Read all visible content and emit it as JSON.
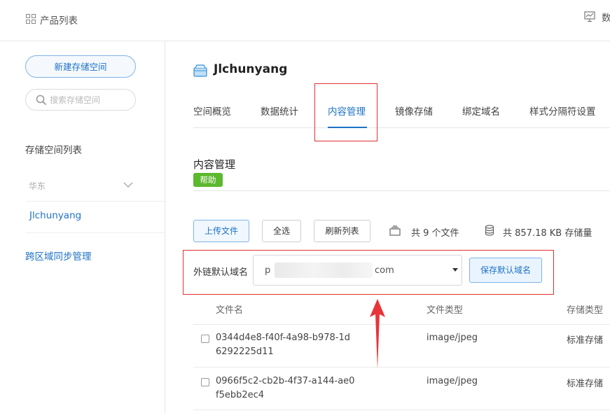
{
  "topbar": {
    "title": "产品列表",
    "right_text": "数"
  },
  "sidebar": {
    "new_bucket_label": "新建存储空间",
    "search_placeholder": "搜索存储空间",
    "list_heading": "存储空间列表",
    "region": "华东",
    "bucket_item": "Jlchunyang",
    "cross_region_link": "跨区域同步管理"
  },
  "main": {
    "bucket_title": "Jlchunyang",
    "tabs": [
      {
        "label": "空间概览"
      },
      {
        "label": "数据统计"
      },
      {
        "label": "内容管理",
        "active": true
      },
      {
        "label": "镜像存储"
      },
      {
        "label": "绑定域名"
      },
      {
        "label": "样式分隔符设置"
      }
    ],
    "section_title": "内容管理",
    "help_label": "帮助",
    "toolbar": {
      "upload_label": "上传文件",
      "select_all_label": "全选",
      "refresh_label": "刷新列表",
      "files_count_text": "共 9 个文件",
      "storage_text": "共 857.18 KB 存储量"
    },
    "domain": {
      "label": "外链默认域名",
      "value_prefix": "p",
      "value_suffix": "com",
      "save_label": "保存默认域名"
    },
    "table": {
      "headers": [
        "文件名",
        "文件类型",
        "存储类型"
      ],
      "rows": [
        {
          "name_line1": "0344d4e8-f40f-4a98-b978-1d",
          "name_line2": "6292225d11",
          "type": "image/jpeg",
          "storage": "标准存储"
        },
        {
          "name_line1": "0966f5c2-cb2b-4f37-a144-ae0",
          "name_line2": "f5ebb2ec4",
          "type": "image/jpeg",
          "storage": "标准存储"
        }
      ]
    }
  },
  "colors": {
    "accent": "#1e72c6",
    "highlight": "#e03030",
    "help": "#5cb82e"
  }
}
